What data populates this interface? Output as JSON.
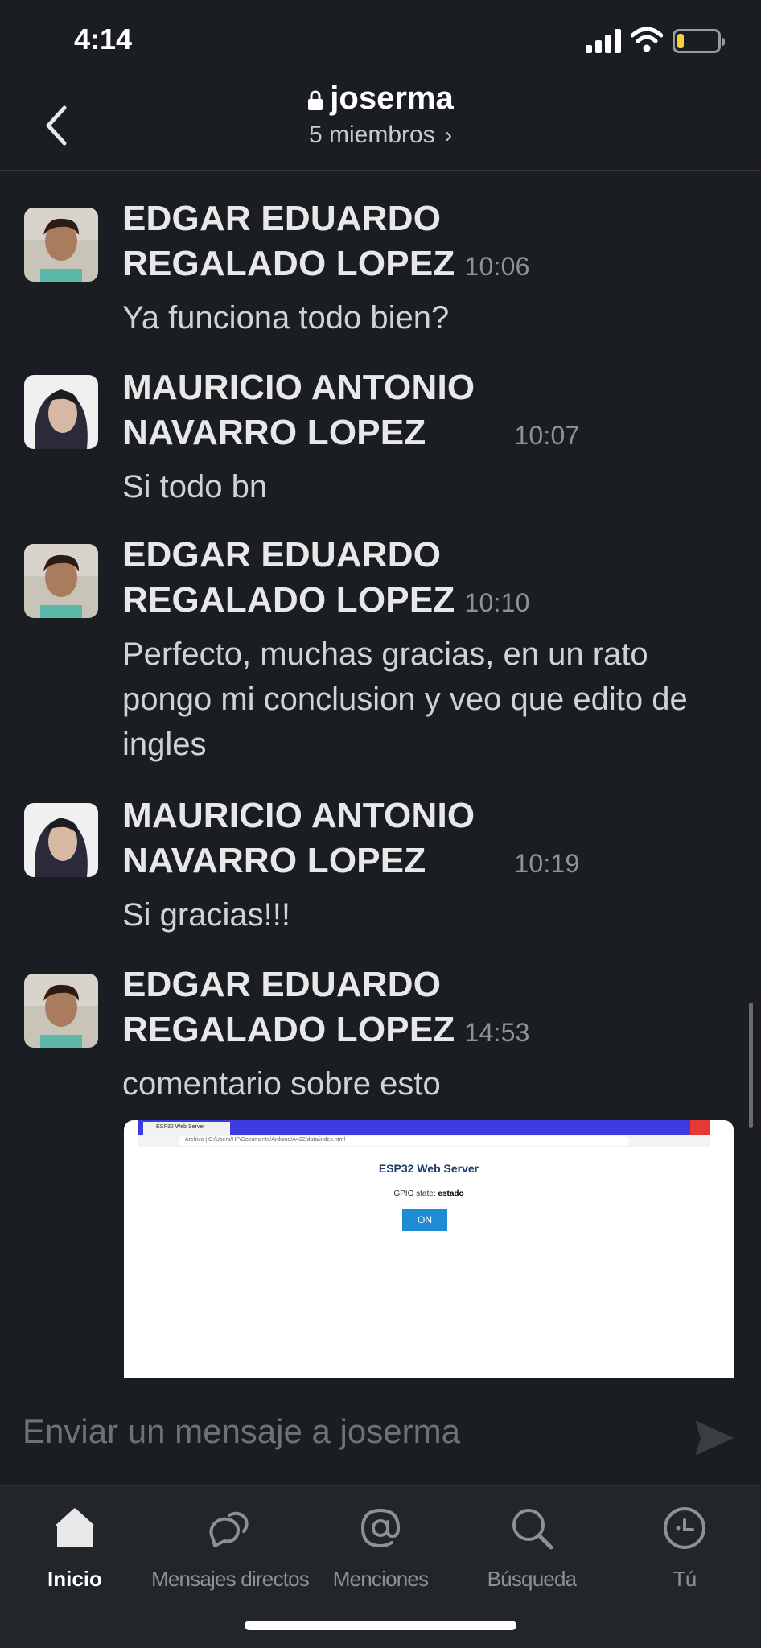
{
  "status_bar": {
    "time": "4:14"
  },
  "header": {
    "channel_name": "joserma",
    "members": "5 miembros"
  },
  "messages": [
    {
      "author_line1": "EDGAR EDUARDO",
      "author_line2": "REGALADO LOPEZ",
      "time": "10:06",
      "text": "Ya funciona todo bien?"
    },
    {
      "author_line1": "MAURICIO ANTONIO",
      "author_line2": "NAVARRO LOPEZ",
      "time": "10:07",
      "text": "Si todo bn"
    },
    {
      "author_line1": "EDGAR EDUARDO",
      "author_line2": "REGALADO LOPEZ",
      "time": "10:10",
      "text": "Perfecto, muchas gracias, en un rato pongo mi conclusion y veo que edito de ingles"
    },
    {
      "author_line1": "MAURICIO ANTONIO",
      "author_line2": "NAVARRO LOPEZ",
      "time": "10:19",
      "text": "Si gracias!!!"
    },
    {
      "author_line1": "EDGAR EDUARDO",
      "author_line2": "REGALADO LOPEZ",
      "time": "14:53",
      "text": "comentario sobre esto"
    }
  ],
  "attachment": {
    "tab_title": "ESP32 Web Server",
    "url": "Archivo | C:/Users/HP/Documents/Arduino/A422/data/index.html",
    "page_title": "ESP32 Web Server",
    "state_label": "GPIO state:",
    "state_value": "estado",
    "button_label": "ON"
  },
  "composer": {
    "placeholder": "Enviar un mensaje a joserma"
  },
  "tabbar": [
    {
      "label": "Inicio",
      "icon": "home-icon",
      "active": true
    },
    {
      "label": "Mensajes directos",
      "icon": "direct-messages-icon",
      "active": false
    },
    {
      "label": "Menciones",
      "icon": "at-sign-icon",
      "active": false
    },
    {
      "label": "Búsqueda",
      "icon": "search-icon",
      "active": false
    },
    {
      "label": "Tú",
      "icon": "profile-icon",
      "active": false
    }
  ]
}
